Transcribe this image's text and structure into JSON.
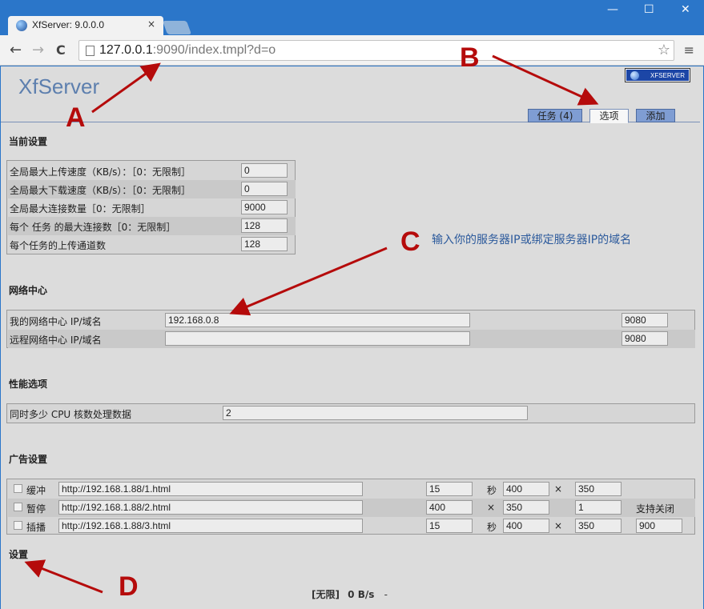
{
  "browser": {
    "tab_title": "XfServer: 9.0.0.0",
    "tab_close": "×",
    "url_host": "127.0.0.1",
    "url_rest": ":9090/index.tmpl?d=o",
    "back": "←",
    "forward": "→",
    "reload": "C",
    "star": "☆",
    "menu": "≡",
    "minimize": "—",
    "maximize": "☐",
    "close": "✕"
  },
  "header": {
    "logo": "XfServer",
    "badge": "XFSERVER",
    "tabs": [
      {
        "label": "任务 (4)"
      },
      {
        "label": "选项"
      },
      {
        "label": "添加"
      }
    ]
  },
  "current_settings": {
    "title": "当前设置",
    "rows": [
      {
        "label": "全局最大上传速度（KB/s）：［0：无限制］",
        "value": "0"
      },
      {
        "label": "全局最大下载速度（KB/s）：［0：无限制］",
        "value": "0"
      },
      {
        "label": "全局最大连接数量［0：无限制］",
        "value": "9000"
      },
      {
        "label": "每个 任务 的最大连接数［0：无限制］",
        "value": "128"
      },
      {
        "label": "每个任务的上传通道数",
        "value": "128"
      }
    ]
  },
  "network_center": {
    "title": "网络中心",
    "rows": [
      {
        "label": "我的网络中心 IP/域名",
        "host": "192.168.0.8",
        "port": "9080"
      },
      {
        "label": "远程网络中心 IP/域名",
        "host": "",
        "port": "9080"
      }
    ]
  },
  "performance": {
    "title": "性能选项",
    "label": "同时多少 CPU 核数处理数据",
    "value": "2"
  },
  "ads": {
    "title": "广告设置",
    "rows": [
      {
        "label": "缓冲",
        "url": "http://192.168.1.88/1.html",
        "a": "15",
        "a_unit": "秒",
        "w": "400",
        "x": "×",
        "h": "350",
        "extra": ""
      },
      {
        "label": "暂停",
        "url": "http://192.168.1.88/2.html",
        "a": "400",
        "a_unit": "×",
        "w": "350",
        "x": "",
        "h": "1",
        "extra": "支持关闭"
      },
      {
        "label": "插播",
        "url": "http://192.168.1.88/3.html",
        "a": "15",
        "a_unit": "秒",
        "w": "400",
        "x": "×",
        "h": "350",
        "extra": "900"
      }
    ]
  },
  "settings_link": "设置",
  "status": {
    "limit": "[无限]",
    "speed": "0 B/s",
    "dash": "-"
  },
  "annotations": {
    "A": "A",
    "B": "B",
    "C": "C",
    "D": "D",
    "note": "输入你的服务器IP或绑定服务器IP的域名"
  },
  "colors": {
    "callout": "#b50b0b",
    "tab_blue": "#7f9dd3",
    "logo": "#5d7fae",
    "frame": "#2b76c9"
  }
}
